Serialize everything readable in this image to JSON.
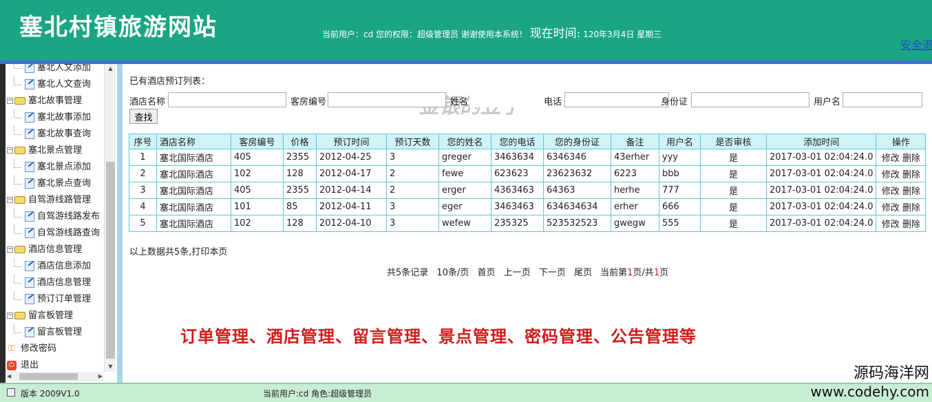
{
  "header": {
    "site_title": "塞北村镇旅游网站",
    "user_info": "当前用户：cd 您的权限：超级管理员 谢谢使用本系统！",
    "time_label": "现在时间:",
    "time_value": "120年3月4日 星期三",
    "logout": "安全退"
  },
  "sidebar": {
    "items": [
      {
        "type": "leaf",
        "label": "塞北人文添加"
      },
      {
        "type": "leaf",
        "label": "塞北人文查询"
      },
      {
        "type": "group",
        "label": "塞北故事管理"
      },
      {
        "type": "leaf",
        "label": "塞北故事添加"
      },
      {
        "type": "leaf",
        "label": "塞北故事查询"
      },
      {
        "type": "group",
        "label": "塞北景点管理"
      },
      {
        "type": "leaf",
        "label": "塞北景点添加"
      },
      {
        "type": "leaf",
        "label": "塞北景点查询"
      },
      {
        "type": "group",
        "label": "自驾游线路管理"
      },
      {
        "type": "leaf",
        "label": "自驾游线路发布"
      },
      {
        "type": "leaf",
        "label": "自驾游线路查询"
      },
      {
        "type": "group",
        "label": "酒店信息管理"
      },
      {
        "type": "leaf",
        "label": "酒店信息添加"
      },
      {
        "type": "leaf",
        "label": "酒店信息管理"
      },
      {
        "type": "leaf",
        "label": "预订订单管理"
      },
      {
        "type": "group",
        "label": "留言板管理"
      },
      {
        "type": "leaf",
        "label": "留言板管理"
      },
      {
        "type": "key",
        "label": "修改密码"
      },
      {
        "type": "exit",
        "label": "退出"
      }
    ]
  },
  "main": {
    "list_title": "已有酒店预订列表：",
    "watermark": "金银的豆子",
    "search": {
      "hotel_label": "酒店名称",
      "room_label": "客房编号",
      "name_label": "姓名",
      "phone_label": "电话",
      "id_label": "身份证",
      "user_label": "用户名",
      "button": "查找"
    },
    "table": {
      "headers": [
        "序号",
        "酒店名称",
        "客房编号",
        "价格",
        "预订时间",
        "预订天数",
        "您的姓名",
        "您的电话",
        "您的身份证",
        "备注",
        "用户名",
        "是否审核",
        "添加时间",
        "操作"
      ],
      "rows": [
        [
          "1",
          "塞北国际酒店",
          "405",
          "2355",
          "2012-04-25",
          "3",
          "greger",
          "3463634",
          "6346346",
          "43erher",
          "yyy",
          "是",
          "2017-03-01 02:04:24.0"
        ],
        [
          "2",
          "塞北国际酒店",
          "102",
          "128",
          "2012-04-17",
          "2",
          "fewe",
          "623623",
          "23623632",
          "6223",
          "bbb",
          "是",
          "2017-03-01 02:04:24.0"
        ],
        [
          "3",
          "塞北国际酒店",
          "405",
          "2355",
          "2012-04-14",
          "2",
          "erger",
          "4363463",
          "64363",
          "herhe",
          "777",
          "是",
          "2017-03-01 02:04:24.0"
        ],
        [
          "4",
          "塞北国际酒店",
          "101",
          "85",
          "2012-04-11",
          "3",
          "eger",
          "3463463",
          "634634634",
          "erher",
          "666",
          "是",
          "2017-03-01 02:04:24.0"
        ],
        [
          "5",
          "塞北国际酒店",
          "102",
          "128",
          "2012-04-10",
          "3",
          "wefew",
          "235325",
          "523532523",
          "gwegw",
          "555",
          "是",
          "2017-03-01 02:04:24.0"
        ]
      ],
      "edit": "修改",
      "delete": "删除"
    },
    "summary": "以上数据共5条,打印本页",
    "pager": {
      "total": "共5条记录",
      "per_page": "10条/页",
      "first": "首页",
      "prev": "上一页",
      "next": "下一页",
      "last": "尾页",
      "cur_prefix": "当前第",
      "cur_page": "1",
      "cur_mid": "页/共",
      "total_pages": "1",
      "cur_suffix": "页"
    },
    "feature_banner": "订单管理、酒店管理、留言管理、景点管理、密码管理、公告管理等"
  },
  "footer": {
    "version": "版本 2009V1.0",
    "current_user": "当前用户:cd  角色:超级管理员"
  },
  "brand": {
    "name": "源码海洋网",
    "url": "www.codehy.com"
  }
}
